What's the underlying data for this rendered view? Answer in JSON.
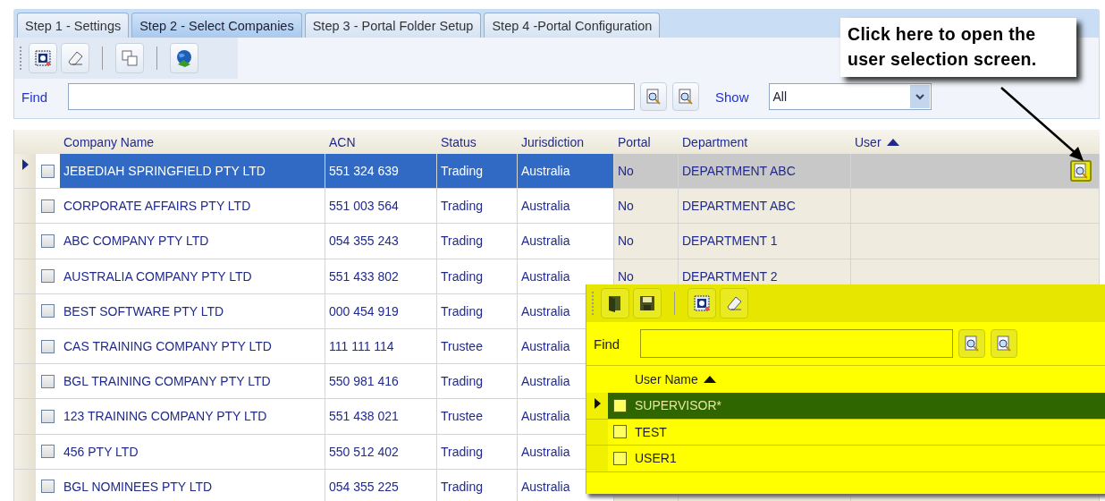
{
  "tabs": [
    {
      "label": "Step 1 - Settings",
      "selected": false
    },
    {
      "label": "Step 2 - Select Companies",
      "selected": true
    },
    {
      "label": "Step 3 - Portal Folder Setup",
      "selected": false
    },
    {
      "label": "Step 4 -Portal Configuration",
      "selected": false
    }
  ],
  "find": {
    "label": "Find"
  },
  "show": {
    "label": "Show",
    "value": "All"
  },
  "table": {
    "columns": [
      {
        "label": "Company Name",
        "sorted": false
      },
      {
        "label": "ACN",
        "sorted": false
      },
      {
        "label": "Status",
        "sorted": false
      },
      {
        "label": "Jurisdiction",
        "sorted": false
      },
      {
        "label": "Portal",
        "sorted": false
      },
      {
        "label": "Department",
        "sorted": false
      },
      {
        "label": "User",
        "sorted": true
      }
    ],
    "rows": [
      {
        "selected": true,
        "checked": false,
        "cells": [
          "JEBEDIAH SPRINGFIELD PTY LTD",
          "551 324 639",
          "Trading",
          "Australia",
          "No",
          "DEPARTMENT ABC"
        ]
      },
      {
        "selected": false,
        "checked": false,
        "cells": [
          "CORPORATE AFFAIRS PTY LTD",
          "551 003 564",
          "Trading",
          "Australia",
          "No",
          "DEPARTMENT ABC"
        ]
      },
      {
        "selected": false,
        "checked": false,
        "cells": [
          "ABC COMPANY PTY LTD",
          "054 355 243",
          "Trading",
          "Australia",
          "No",
          "DEPARTMENT 1"
        ]
      },
      {
        "selected": false,
        "checked": false,
        "cells": [
          "AUSTRALIA COMPANY PTY LTD",
          "551 433 802",
          "Trading",
          "Australia",
          "No",
          "DEPARTMENT 2"
        ]
      },
      {
        "selected": false,
        "checked": false,
        "cells": [
          "BEST SOFTWARE PTY LTD",
          "000 454 919",
          "Trading",
          "Australia"
        ]
      },
      {
        "selected": false,
        "checked": false,
        "cells": [
          "CAS TRAINING COMPANY PTY LTD",
          "111 111 114",
          "Trustee",
          "Australia"
        ]
      },
      {
        "selected": false,
        "checked": false,
        "cells": [
          "BGL TRAINING COMPANY PTY LTD",
          "550 981 416",
          "Trading",
          "Australia"
        ]
      },
      {
        "selected": false,
        "checked": false,
        "cells": [
          "123 TRAINING COMPANY PTY LTD",
          "551 438 021",
          "Trustee",
          "Australia"
        ]
      },
      {
        "selected": false,
        "checked": false,
        "cells": [
          "456 PTY LTD",
          "550 512 402",
          "Trading",
          "Australia"
        ]
      },
      {
        "selected": false,
        "checked": false,
        "cells": [
          "BGL NOMINEES PTY LTD",
          "054 355 225",
          "Trading",
          "Australia"
        ]
      }
    ]
  },
  "callout": {
    "text": "Click here to open the user selection screen."
  },
  "user_popup": {
    "find_label": "Find",
    "columns": [
      {
        "label": "User Name",
        "sorted": true
      }
    ],
    "rows": [
      {
        "name": "SUPERVISOR*",
        "selected": true,
        "checked": false
      },
      {
        "name": "TEST",
        "selected": false,
        "checked": false
      },
      {
        "name": "USER1",
        "selected": false,
        "checked": false
      }
    ]
  }
}
